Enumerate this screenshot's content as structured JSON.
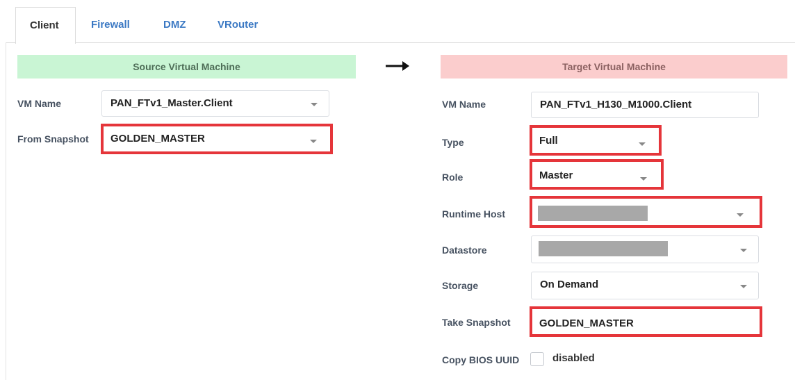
{
  "tabs": [
    {
      "label": "Client",
      "active": true
    },
    {
      "label": "Firewall"
    },
    {
      "label": "DMZ"
    },
    {
      "label": "VRouter"
    }
  ],
  "source": {
    "header": "Source Virtual Machine",
    "vm_name_label": "VM Name",
    "vm_name_value": "PAN_FTv1_Master.Client",
    "snapshot_label": "From Snapshot",
    "snapshot_value": "GOLDEN_MASTER"
  },
  "target": {
    "header": "Target Virtual Machine",
    "vm_name_label": "VM Name",
    "vm_name_value": "PAN_FTv1_H130_M1000.Client",
    "type_label": "Type",
    "type_value": "Full",
    "role_label": "Role",
    "role_value": "Master",
    "runtime_host_label": "Runtime Host",
    "datastore_label": "Datastore",
    "storage_label": "Storage",
    "storage_value": "On Demand",
    "take_snapshot_label": "Take Snapshot",
    "take_snapshot_value": "GOLDEN_MASTER",
    "copy_bios_label": "Copy BIOS UUID",
    "copy_bios_value": "disabled"
  },
  "colors": {
    "source_header_bg": "#c9f5d4",
    "target_header_bg": "#fbcdcd",
    "highlight": "#e5353a",
    "tab_link": "#3a78c3"
  },
  "icons": {
    "arrow": "arrow-right-icon",
    "dropdown": "chevron-down-icon"
  }
}
